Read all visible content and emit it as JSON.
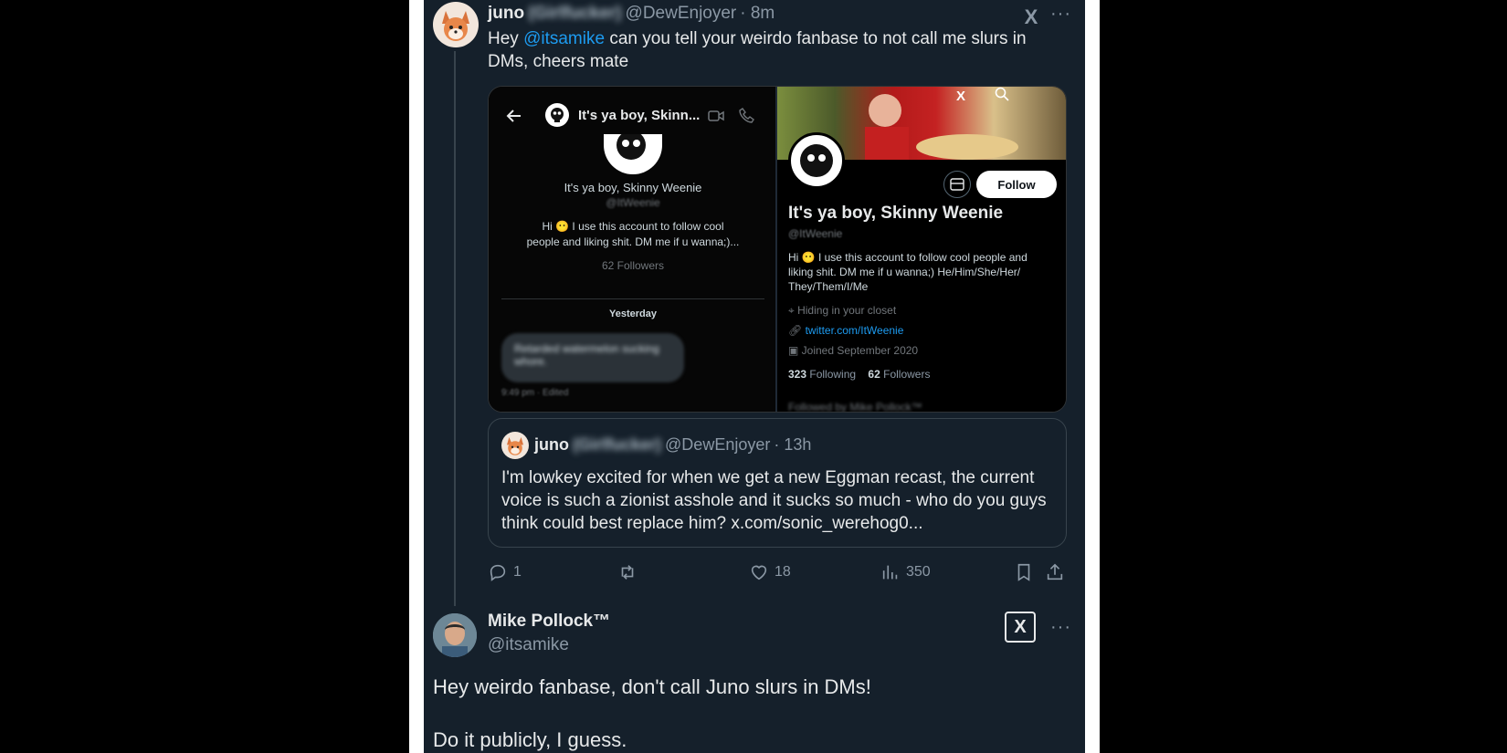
{
  "tweet": {
    "display_name": "juno",
    "blurred_name": "(Girlfucker)",
    "handle": "@DewEnjoyer",
    "time": "· 8m",
    "text_before": "Hey ",
    "mention": "@itsamike",
    "text_after": " can you tell your weirdo fanbase to not call me slurs in DMs, cheers mate",
    "more_icon": "more-dots-icon"
  },
  "media_left": {
    "title": "It's ya boy, Skinn...",
    "name": "It's ya boy, Skinny Weenie",
    "handle": "@ItWeenie",
    "bio_line1": "Hi 😶 I use this account to follow cool",
    "bio_line2": "people and liking shit. DM me if u wanna;)...",
    "followers": "62 Followers",
    "day_label": "Yesterday",
    "message_blurred": "Retarded watermelon sucking whore.",
    "message_time": "9:49 pm · Edited"
  },
  "media_right": {
    "follow_label": "Follow",
    "name": "It's ya boy, Skinny Weenie",
    "handle": "@ItWeenie",
    "bio_line1": "Hi 😶 I use this account to follow cool people and",
    "bio_line2": "liking shit. DM me if u wanna;) He/Him/She/Her/",
    "bio_line3": "They/Them/I/Me",
    "location": "Hiding in your closet",
    "link": "twitter.com/ItWeenie",
    "joined": "Joined September 2020",
    "following_count": "323",
    "following_label": "Following",
    "followers_count": "62",
    "followers_label": "Followers",
    "followed_by": "Followed by Mike Pollock™"
  },
  "quote": {
    "display_name": "juno",
    "blurred_name": "(Girlfucker)",
    "handle": "@DewEnjoyer",
    "time": "· 13h",
    "text": "I'm lowkey excited for when we get a new Eggman recast, the current voice is such a zionist asshole and it sucks so much - who do you guys think could best replace him? x.com/sonic_werehog0..."
  },
  "actions": {
    "replies": "1",
    "retweets": "",
    "likes": "18",
    "views": "350"
  },
  "reply": {
    "display_name": "Mike Pollock™",
    "handle": "@itsamike",
    "line1": "Hey weirdo fanbase, don't call Juno slurs in DMs!",
    "line2": "Do it publicly, I guess."
  },
  "badge_text": "X"
}
